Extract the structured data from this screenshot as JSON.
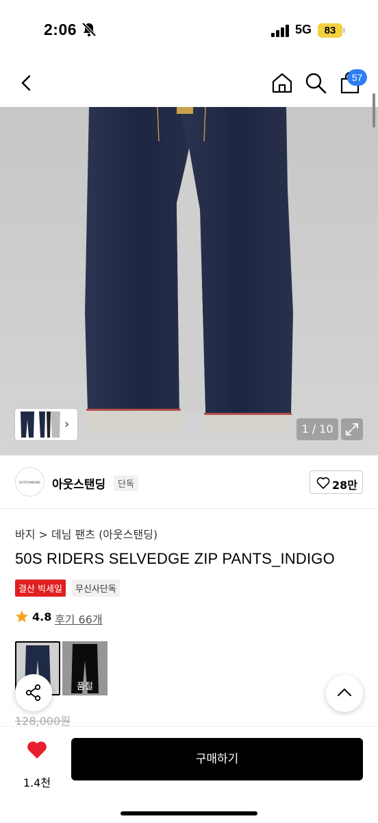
{
  "status_bar": {
    "time": "2:06",
    "network": "5G",
    "battery": "83"
  },
  "nav": {
    "cart_count": "57",
    "icons": [
      "back-icon",
      "home-icon",
      "search-icon",
      "shopping-bag-icon"
    ]
  },
  "gallery": {
    "counter": "1 / 10"
  },
  "brand": {
    "logo_text": "OUTSTANDING",
    "name": "아웃스탠딩",
    "tag": "단독",
    "likes": "28만"
  },
  "product": {
    "breadcrumb": "바지 > 데님 팬츠 (아웃스탠딩)",
    "title": "50S RIDERS SELVEDGE ZIP PANTS_INDIGO",
    "tags": [
      "결산 빅세일",
      "무신사단독"
    ],
    "rating": "4.8",
    "reviews": "후기 66개",
    "colors": [
      {
        "name": "indigo",
        "color": "#1f2a44",
        "sold_out": ""
      },
      {
        "name": "black",
        "color": "#111111",
        "sold_out": "품절"
      }
    ],
    "original_price": "128,000원"
  },
  "bottom_bar": {
    "wishlist_count": "1.4천",
    "buy_label": "구매하기",
    "heart_color": "#e81e2d"
  }
}
